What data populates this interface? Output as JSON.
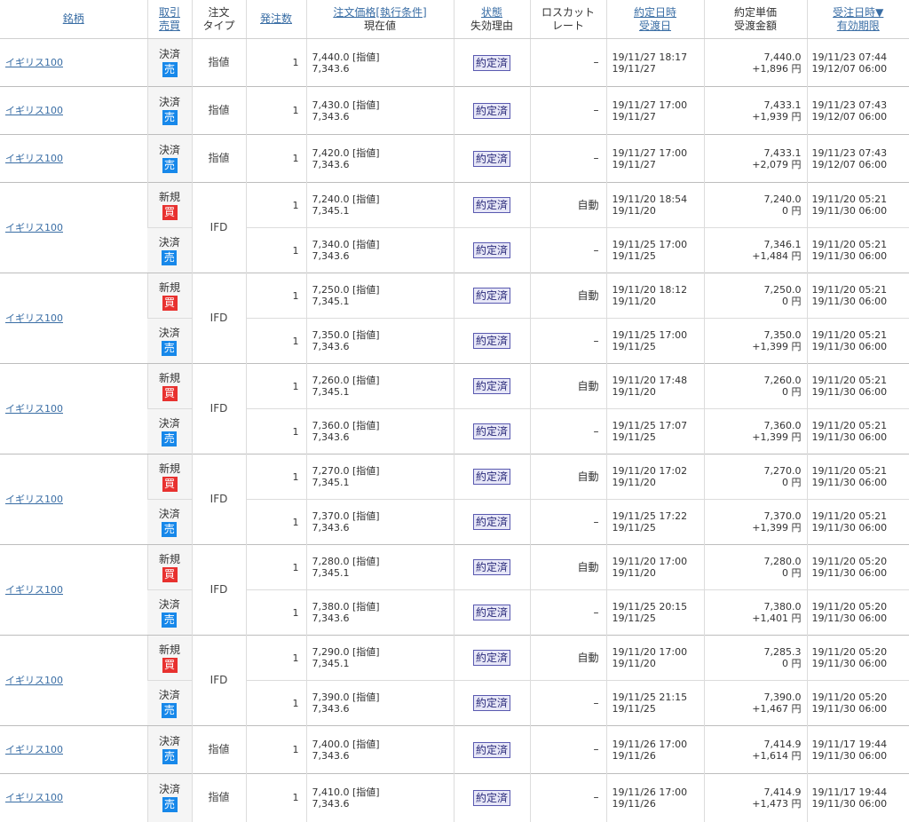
{
  "header": {
    "symbol": "銘柄",
    "trade_side_1": "取引",
    "trade_side_2": "売買",
    "order_type_1": "注文",
    "order_type_2": "タイプ",
    "quantity": "発注数",
    "price_1": "注文価格[執行条件]",
    "price_2": "現在値",
    "status_1": "状態",
    "status_2": "失効理由",
    "losscut_1": "ロスカット",
    "losscut_2": "レート",
    "exec_1": "約定日時",
    "exec_2": "受渡日",
    "amount_1": "約定単価",
    "amount_2": "受渡金額",
    "recv_1": "受注日時▼",
    "recv_2": "有効期限"
  },
  "groups": [
    {
      "symbol": "イギリス100",
      "type": "指値",
      "legs": [
        {
          "side": "決済",
          "action": "売",
          "action_kind": "sell",
          "qty": "1",
          "price": "7,440.0 [指値]",
          "current": "7,343.6",
          "status": "約定済",
          "losscut": "–",
          "exec_time": "19/11/27 18:17",
          "settle_date": "19/11/27",
          "unit_price": "7,440.0",
          "amount": "+1,896 円",
          "received": "19/11/23 07:44",
          "expiry": "19/12/07 06:00"
        }
      ]
    },
    {
      "symbol": "イギリス100",
      "type": "指値",
      "legs": [
        {
          "side": "決済",
          "action": "売",
          "action_kind": "sell",
          "qty": "1",
          "price": "7,430.0 [指値]",
          "current": "7,343.6",
          "status": "約定済",
          "losscut": "–",
          "exec_time": "19/11/27 17:00",
          "settle_date": "19/11/27",
          "unit_price": "7,433.1",
          "amount": "+1,939 円",
          "received": "19/11/23 07:43",
          "expiry": "19/12/07 06:00"
        }
      ]
    },
    {
      "symbol": "イギリス100",
      "type": "指値",
      "legs": [
        {
          "side": "決済",
          "action": "売",
          "action_kind": "sell",
          "qty": "1",
          "price": "7,420.0 [指値]",
          "current": "7,343.6",
          "status": "約定済",
          "losscut": "–",
          "exec_time": "19/11/27 17:00",
          "settle_date": "19/11/27",
          "unit_price": "7,433.1",
          "amount": "+2,079 円",
          "received": "19/11/23 07:43",
          "expiry": "19/12/07 06:00"
        }
      ]
    },
    {
      "symbol": "イギリス100",
      "type": "IFD",
      "legs": [
        {
          "side": "新規",
          "action": "買",
          "action_kind": "buy",
          "qty": "1",
          "price": "7,240.0 [指値]",
          "current": "7,345.1",
          "status": "約定済",
          "losscut": "自動",
          "exec_time": "19/11/20 18:54",
          "settle_date": "19/11/20",
          "unit_price": "7,240.0",
          "amount": "0 円",
          "received": "19/11/20 05:21",
          "expiry": "19/11/30 06:00"
        },
        {
          "side": "決済",
          "action": "売",
          "action_kind": "sell",
          "qty": "1",
          "price": "7,340.0 [指値]",
          "current": "7,343.6",
          "status": "約定済",
          "losscut": "–",
          "exec_time": "19/11/25 17:00",
          "settle_date": "19/11/25",
          "unit_price": "7,346.1",
          "amount": "+1,484 円",
          "received": "19/11/20 05:21",
          "expiry": "19/11/30 06:00"
        }
      ]
    },
    {
      "symbol": "イギリス100",
      "type": "IFD",
      "legs": [
        {
          "side": "新規",
          "action": "買",
          "action_kind": "buy",
          "qty": "1",
          "price": "7,250.0 [指値]",
          "current": "7,345.1",
          "status": "約定済",
          "losscut": "自動",
          "exec_time": "19/11/20 18:12",
          "settle_date": "19/11/20",
          "unit_price": "7,250.0",
          "amount": "0 円",
          "received": "19/11/20 05:21",
          "expiry": "19/11/30 06:00"
        },
        {
          "side": "決済",
          "action": "売",
          "action_kind": "sell",
          "qty": "1",
          "price": "7,350.0 [指値]",
          "current": "7,343.6",
          "status": "約定済",
          "losscut": "–",
          "exec_time": "19/11/25 17:00",
          "settle_date": "19/11/25",
          "unit_price": "7,350.0",
          "amount": "+1,399 円",
          "received": "19/11/20 05:21",
          "expiry": "19/11/30 06:00"
        }
      ]
    },
    {
      "symbol": "イギリス100",
      "type": "IFD",
      "legs": [
        {
          "side": "新規",
          "action": "買",
          "action_kind": "buy",
          "qty": "1",
          "price": "7,260.0 [指値]",
          "current": "7,345.1",
          "status": "約定済",
          "losscut": "自動",
          "exec_time": "19/11/20 17:48",
          "settle_date": "19/11/20",
          "unit_price": "7,260.0",
          "amount": "0 円",
          "received": "19/11/20 05:21",
          "expiry": "19/11/30 06:00"
        },
        {
          "side": "決済",
          "action": "売",
          "action_kind": "sell",
          "qty": "1",
          "price": "7,360.0 [指値]",
          "current": "7,343.6",
          "status": "約定済",
          "losscut": "–",
          "exec_time": "19/11/25 17:07",
          "settle_date": "19/11/25",
          "unit_price": "7,360.0",
          "amount": "+1,399 円",
          "received": "19/11/20 05:21",
          "expiry": "19/11/30 06:00"
        }
      ]
    },
    {
      "symbol": "イギリス100",
      "type": "IFD",
      "legs": [
        {
          "side": "新規",
          "action": "買",
          "action_kind": "buy",
          "qty": "1",
          "price": "7,270.0 [指値]",
          "current": "7,345.1",
          "status": "約定済",
          "losscut": "自動",
          "exec_time": "19/11/20 17:02",
          "settle_date": "19/11/20",
          "unit_price": "7,270.0",
          "amount": "0 円",
          "received": "19/11/20 05:21",
          "expiry": "19/11/30 06:00"
        },
        {
          "side": "決済",
          "action": "売",
          "action_kind": "sell",
          "qty": "1",
          "price": "7,370.0 [指値]",
          "current": "7,343.6",
          "status": "約定済",
          "losscut": "–",
          "exec_time": "19/11/25 17:22",
          "settle_date": "19/11/25",
          "unit_price": "7,370.0",
          "amount": "+1,399 円",
          "received": "19/11/20 05:21",
          "expiry": "19/11/30 06:00"
        }
      ]
    },
    {
      "symbol": "イギリス100",
      "type": "IFD",
      "legs": [
        {
          "side": "新規",
          "action": "買",
          "action_kind": "buy",
          "qty": "1",
          "price": "7,280.0 [指値]",
          "current": "7,345.1",
          "status": "約定済",
          "losscut": "自動",
          "exec_time": "19/11/20 17:00",
          "settle_date": "19/11/20",
          "unit_price": "7,280.0",
          "amount": "0 円",
          "received": "19/11/20 05:20",
          "expiry": "19/11/30 06:00"
        },
        {
          "side": "決済",
          "action": "売",
          "action_kind": "sell",
          "qty": "1",
          "price": "7,380.0 [指値]",
          "current": "7,343.6",
          "status": "約定済",
          "losscut": "–",
          "exec_time": "19/11/25 20:15",
          "settle_date": "19/11/25",
          "unit_price": "7,380.0",
          "amount": "+1,401 円",
          "received": "19/11/20 05:20",
          "expiry": "19/11/30 06:00"
        }
      ]
    },
    {
      "symbol": "イギリス100",
      "type": "IFD",
      "legs": [
        {
          "side": "新規",
          "action": "買",
          "action_kind": "buy",
          "qty": "1",
          "price": "7,290.0 [指値]",
          "current": "7,345.1",
          "status": "約定済",
          "losscut": "自動",
          "exec_time": "19/11/20 17:00",
          "settle_date": "19/11/20",
          "unit_price": "7,285.3",
          "amount": "0 円",
          "received": "19/11/20 05:20",
          "expiry": "19/11/30 06:00"
        },
        {
          "side": "決済",
          "action": "売",
          "action_kind": "sell",
          "qty": "1",
          "price": "7,390.0 [指値]",
          "current": "7,343.6",
          "status": "約定済",
          "losscut": "–",
          "exec_time": "19/11/25 21:15",
          "settle_date": "19/11/25",
          "unit_price": "7,390.0",
          "amount": "+1,467 円",
          "received": "19/11/20 05:20",
          "expiry": "19/11/30 06:00"
        }
      ]
    },
    {
      "symbol": "イギリス100",
      "type": "指値",
      "legs": [
        {
          "side": "決済",
          "action": "売",
          "action_kind": "sell",
          "qty": "1",
          "price": "7,400.0 [指値]",
          "current": "7,343.6",
          "status": "約定済",
          "losscut": "–",
          "exec_time": "19/11/26 17:00",
          "settle_date": "19/11/26",
          "unit_price": "7,414.9",
          "amount": "+1,614 円",
          "received": "19/11/17 19:44",
          "expiry": "19/11/30 06:00"
        }
      ]
    },
    {
      "symbol": "イギリス100",
      "type": "指値",
      "legs": [
        {
          "side": "決済",
          "action": "売",
          "action_kind": "sell",
          "qty": "1",
          "price": "7,410.0 [指値]",
          "current": "7,343.6",
          "status": "約定済",
          "losscut": "–",
          "exec_time": "19/11/26 17:00",
          "settle_date": "19/11/26",
          "unit_price": "7,414.9",
          "amount": "+1,473 円",
          "received": "19/11/17 19:44",
          "expiry": "19/11/30 06:00"
        }
      ]
    }
  ]
}
